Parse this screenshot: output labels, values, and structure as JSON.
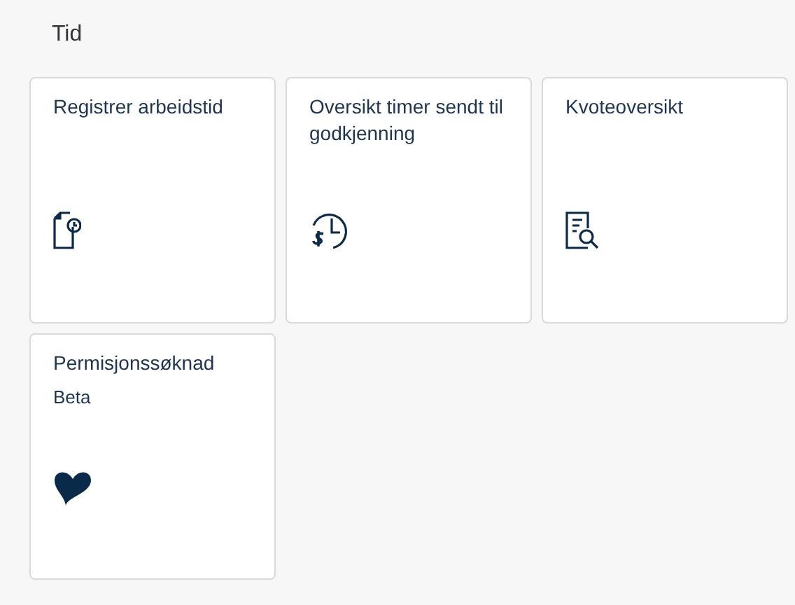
{
  "section": {
    "title": "Tid"
  },
  "tiles": [
    {
      "title": "Registrer arbeidstid"
    },
    {
      "title": "Oversikt timer sendt til godkjenning"
    },
    {
      "title": "Kvoteoversikt"
    },
    {
      "title": "Permisjonssøknad",
      "subtitle": "Beta"
    }
  ]
}
